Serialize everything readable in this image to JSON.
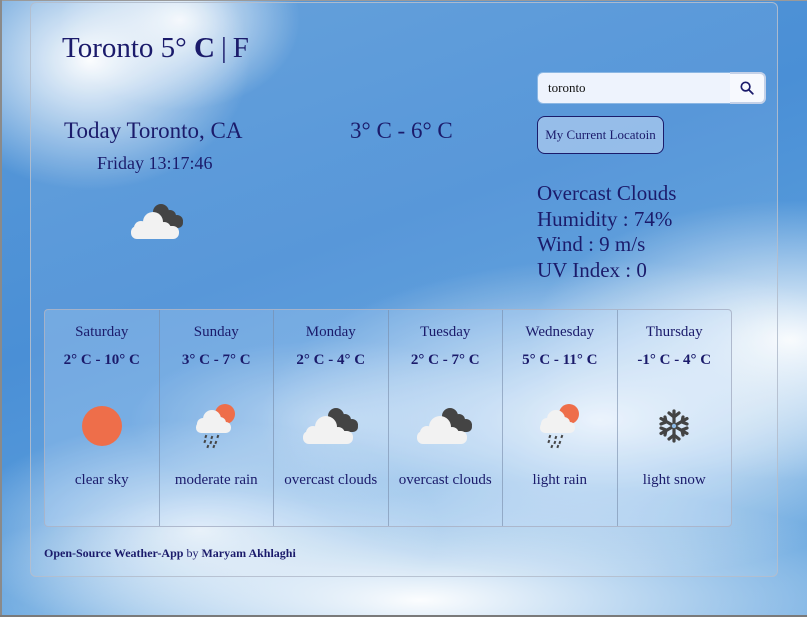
{
  "header": {
    "city": "Toronto",
    "temperature": "5°",
    "unit_c": "C",
    "separator": "|",
    "unit_f": "F"
  },
  "search": {
    "value": "toronto",
    "placeholder": "",
    "button_icon": "search-icon"
  },
  "location_button": {
    "label": "My Current Locatoin"
  },
  "today": {
    "label": "Today Toronto, CA",
    "datetime": "Friday 13:17:46",
    "range": "3° C - 6° C",
    "icon": "overcast-clouds-icon"
  },
  "details": {
    "condition": "Overcast Clouds",
    "humidity": "Humidity : 74%",
    "wind": "Wind : 9 m/s",
    "uv": "UV Index : 0"
  },
  "forecast": [
    {
      "day": "Saturday",
      "range": "2° C - 10° C",
      "icon": "clear-sky-icon",
      "desc": "clear sky"
    },
    {
      "day": "Sunday",
      "range": "3° C - 7° C",
      "icon": "rain-sun-icon",
      "desc": "moderate rain"
    },
    {
      "day": "Monday",
      "range": "2° C - 4° C",
      "icon": "overcast-clouds-icon",
      "desc": "overcast clouds"
    },
    {
      "day": "Tuesday",
      "range": "2° C - 7° C",
      "icon": "overcast-clouds-icon",
      "desc": "overcast clouds"
    },
    {
      "day": "Wednesday",
      "range": "5° C - 11° C",
      "icon": "rain-sun-icon",
      "desc": "light rain"
    },
    {
      "day": "Thursday",
      "range": "-1° C - 4° C",
      "icon": "snow-icon",
      "desc": "light snow"
    }
  ],
  "footer": {
    "project_link": "Open-Source Weather-App",
    "by": "by",
    "author_link": "Maryam Akhlaghi"
  },
  "colors": {
    "text": "#1b1b6b",
    "sun": "#ee6e4a",
    "cloud_light": "#f2f2f2",
    "cloud_dark": "#444444"
  }
}
